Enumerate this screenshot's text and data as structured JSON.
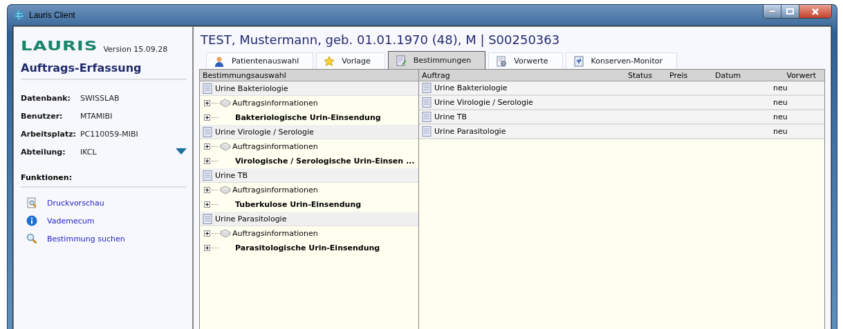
{
  "window": {
    "title": "Lauris Client"
  },
  "sidebar": {
    "logo": "LAURIS",
    "version": "Version 15.09.28",
    "heading": "Auftrags-Erfassung",
    "info": [
      {
        "label": "Datenbank:",
        "value": "SWISSLAB"
      },
      {
        "label": "Benutzer:",
        "value": "MTAMIBI"
      },
      {
        "label": "Arbeitsplatz:",
        "value": "PC110059-MIBI"
      },
      {
        "label": "Abteilung:",
        "value": "IKCL",
        "kind": "dropdown"
      }
    ],
    "functions_heading": "Funktionen:",
    "functions": [
      {
        "label": "Druckvorschau",
        "kind": "preview"
      },
      {
        "label": "Vademecum",
        "kind": "info"
      },
      {
        "label": "Bestimmung suchen",
        "kind": "search"
      }
    ]
  },
  "patient_header": "TEST, Mustermann, geb. 01.01.1970 (48), M | S00250363",
  "tabs": [
    {
      "label": "Patientenauswahl",
      "kind": "person",
      "selected": false
    },
    {
      "label": "Vorlage",
      "kind": "star",
      "selected": false
    },
    {
      "label": "Bestimmungen",
      "kind": "edit",
      "selected": true
    },
    {
      "label": "Vorwerte",
      "kind": "doc",
      "selected": false
    },
    {
      "label": "Konserven-Monitor",
      "kind": "monitor",
      "selected": false
    }
  ],
  "tree": {
    "heading": "Bestimmungsauswahl",
    "groups": [
      {
        "label": "Urine Bakteriologie",
        "children": [
          {
            "label": "Auftragsinformationen",
            "kind": "info",
            "expanded": false
          },
          {
            "label": "Bakteriologische Urin-Einsendung",
            "kind": "order",
            "expanded": false
          }
        ]
      },
      {
        "label": "Urine Virologie / Serologie",
        "children": [
          {
            "label": "Auftragsinformationen",
            "kind": "info",
            "expanded": false
          },
          {
            "label": "Virologische / Serologische Urin-Einsen ...",
            "kind": "order",
            "expanded": false
          }
        ]
      },
      {
        "label": "Urine TB",
        "children": [
          {
            "label": "Auftragsinformationen",
            "kind": "info",
            "expanded": false
          },
          {
            "label": "Tuberkulose Urin-Einsendung",
            "kind": "order",
            "expanded": false
          }
        ]
      },
      {
        "label": "Urine Parasitologie",
        "children": [
          {
            "label": "Auftragsinformationen",
            "kind": "info",
            "expanded": false
          },
          {
            "label": "Parasitologische Urin-Einsendung",
            "kind": "order",
            "expanded": false
          }
        ]
      }
    ]
  },
  "table": {
    "columns": [
      "Auftrag",
      "Status",
      "Preis",
      "Datum",
      "Vorwert"
    ],
    "rows": [
      {
        "auftrag": "Urine Bakteriologie",
        "vorwert": "neu"
      },
      {
        "auftrag": "Urine Virologie / Serologie",
        "vorwert": "neu"
      },
      {
        "auftrag": "Urine TB",
        "vorwert": "neu"
      },
      {
        "auftrag": "Urine Parasitologie",
        "vorwert": "neu"
      }
    ]
  }
}
